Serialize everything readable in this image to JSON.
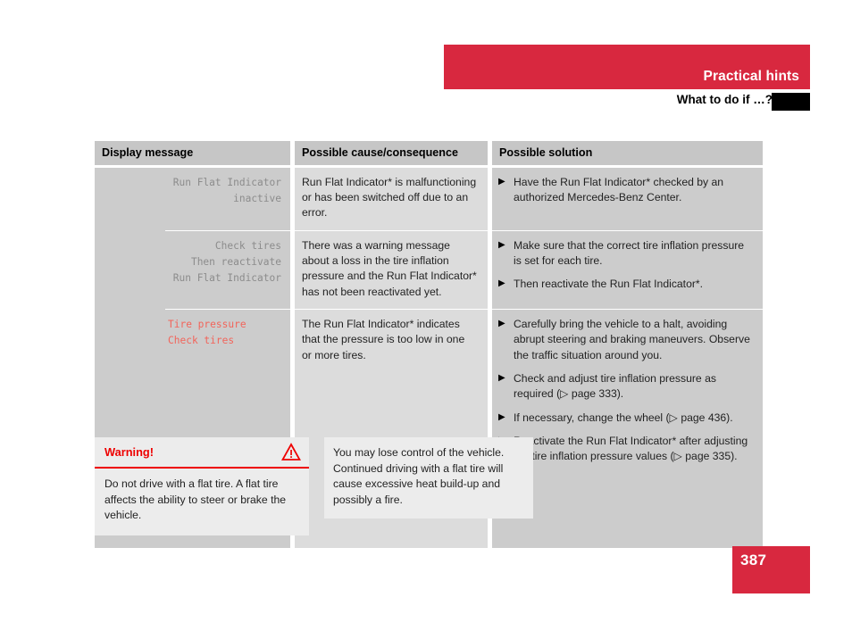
{
  "header": {
    "chapter": "Practical hints",
    "section": "What to do if …?",
    "accent_color": "#d8283f",
    "tab_color": "#000000"
  },
  "table": {
    "columns": [
      "Display message",
      "Possible cause/consequence",
      "Possible solution"
    ],
    "rows": [
      {
        "message_lines": "Run Flat Indicator\ninactive",
        "message_color": "gray",
        "cause": "Run Flat Indicator* is malfunctioning or has been switched off due to an error.",
        "solutions": [
          "Have the Run Flat Indicator* checked by an authorized Mercedes-Benz Center."
        ]
      },
      {
        "message_lines": "Check tires\nThen reactivate\nRun Flat Indicator",
        "message_color": "gray",
        "cause": "There was a warning message about a loss in the tire inflation pressure and the Run Flat Indicator* has not been reactivated yet.",
        "solutions": [
          "Make sure that the correct tire inflation pressure is set for each tire.",
          "Then reactivate the Run Flat Indicator*."
        ]
      },
      {
        "message_lines": "Tire pressure\nCheck tires",
        "message_color": "red",
        "cause": "The Run Flat Indicator* indicates that the pressure is too low in one or more tires.",
        "solutions": [
          "Carefully bring the vehicle to a halt, avoiding abrupt steering and braking maneuvers. Observe the traffic situation around you.",
          "Check and adjust tire inflation pressure as required (▷ page 333).",
          "If necessary, change the wheel (▷ page 436).",
          "Reactivate the Run Flat Indicator* after adjusting the tire inflation pressure values (▷ page 335)."
        ]
      }
    ],
    "bullet_glyph": "▶"
  },
  "warning": {
    "title": "Warning!",
    "icon": "warning-triangle-icon",
    "icon_color": "#ee0000",
    "body": "Do not drive with a flat tire. A flat tire affects the ability to steer or brake the vehicle."
  },
  "note": {
    "body": "You may lose control of the vehicle. Continued driving with a flat tire will cause excessive heat build-up and possibly a fire."
  },
  "footer": {
    "page_number": "387"
  }
}
